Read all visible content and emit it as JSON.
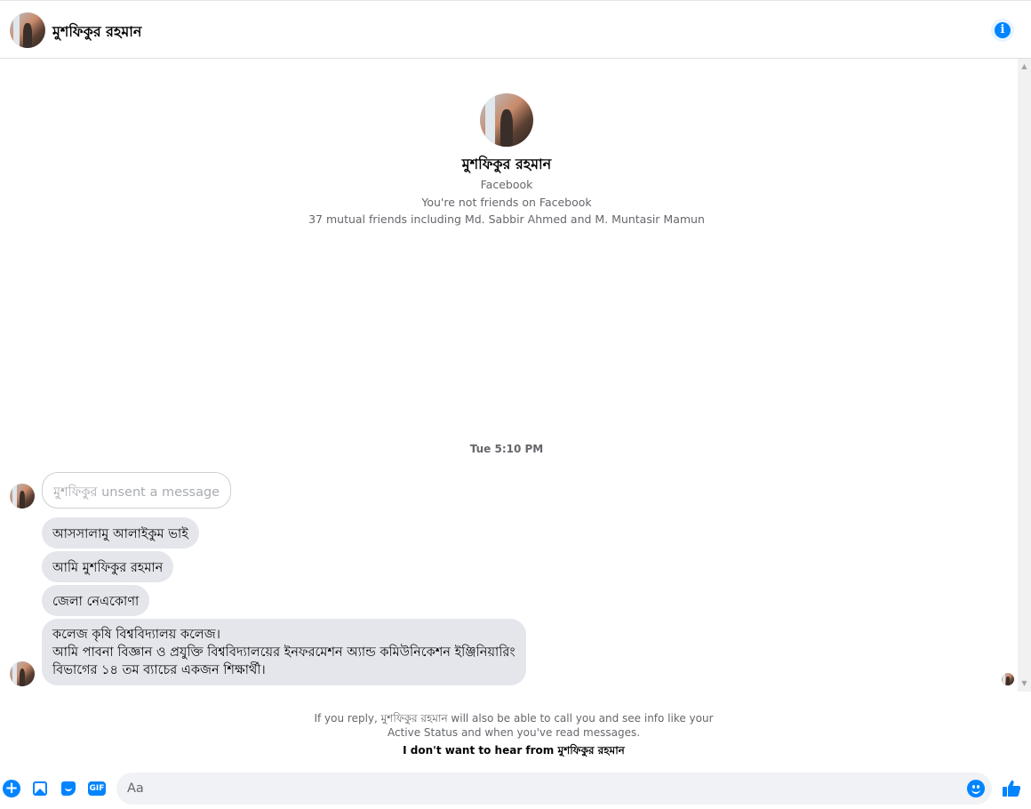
{
  "header": {
    "contact_name": "মুশফিকুর রহমান"
  },
  "intro": {
    "name": "মুশফিকুর রহমান",
    "platform": "Facebook",
    "friend_status": "You're not friends on Facebook",
    "mutual_friends": "37 mutual friends including Md. Sabbir Ahmed and M. Muntasir Mamun"
  },
  "conversation": {
    "timestamp": "Tue 5:10 PM",
    "unsent_notice": "মুশফিকুর unsent a message",
    "messages": [
      "আসসালামু আলাইকুম ভাই",
      "আমি মুশফিকুর রহমান",
      "জেলা নেএকোণা",
      "কলেজ কৃষি বিশ্ববিদ্যালয় কলেজ।",
      "আমি পাবনা বিজ্ঞান ও প্রযুক্তি বিশ্ববিদ্যালয়ের ইনফরমেশন অ্যান্ড কমিউনিকেশন ইঞ্জিনিয়ারিং",
      "বিভাগের ১৪ তম ব্যাচের একজন শিক্ষার্থী।"
    ]
  },
  "footer": {
    "reply_note_line1": "If you reply, মুশফিকুর রহমান will also be able to call you and see info like your",
    "reply_note_line2": "Active Status and when you've read messages.",
    "block_link": "I don't want to hear from মুশফিকুর রহমান"
  },
  "composer": {
    "placeholder": "Aa",
    "gif_label": "GIF",
    "plus_label": "+"
  },
  "colors": {
    "accent": "#0084ff",
    "bubble_bg": "#e4e6eb",
    "muted_text": "#65676b"
  },
  "icons": [
    "info-icon",
    "plus-icon",
    "photo-icon",
    "sticker-icon",
    "gif-icon",
    "emoji-icon",
    "like-icon"
  ]
}
